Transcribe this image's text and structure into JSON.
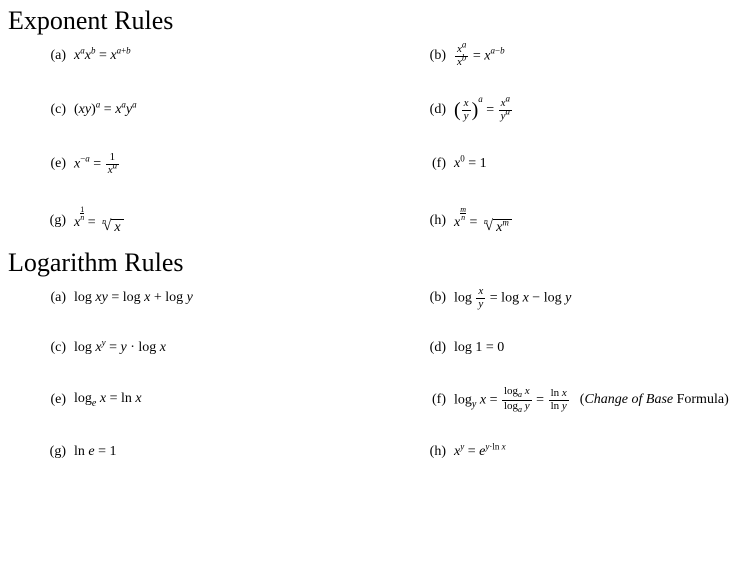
{
  "sections": {
    "exponent": {
      "title": "Exponent Rules",
      "items": {
        "a": {
          "label": "(a)"
        },
        "b": {
          "label": "(b)"
        },
        "c": {
          "label": "(c)"
        },
        "d": {
          "label": "(d)"
        },
        "e": {
          "label": "(e)"
        },
        "f": {
          "label": "(f)"
        },
        "g": {
          "label": "(g)"
        },
        "h": {
          "label": "(h)"
        }
      }
    },
    "logarithm": {
      "title": "Logarithm Rules",
      "items": {
        "a": {
          "label": "(a)"
        },
        "b": {
          "label": "(b)"
        },
        "c": {
          "label": "(c)"
        },
        "d": {
          "label": "(d)"
        },
        "e": {
          "label": "(e)"
        },
        "f": {
          "label": "(f)",
          "note_italic": "Change of Base",
          "note_plain": " Formula"
        },
        "g": {
          "label": "(g)"
        },
        "h": {
          "label": "(h)"
        }
      }
    }
  },
  "chart_data": [
    {
      "type": "table",
      "title": "Exponent Rules",
      "rows": [
        {
          "label": "(a)",
          "rule": "x^a * x^b = x^(a+b)"
        },
        {
          "label": "(b)",
          "rule": "x^a / x^b = x^(a-b)"
        },
        {
          "label": "(c)",
          "rule": "(xy)^a = x^a * y^a"
        },
        {
          "label": "(d)",
          "rule": "(x/y)^a = x^a / y^a"
        },
        {
          "label": "(e)",
          "rule": "x^(-a) = 1 / x^a"
        },
        {
          "label": "(f)",
          "rule": "x^0 = 1"
        },
        {
          "label": "(g)",
          "rule": "x^(1/n) = n-th root of x"
        },
        {
          "label": "(h)",
          "rule": "x^(m/n) = n-th root of x^m"
        }
      ]
    },
    {
      "type": "table",
      "title": "Logarithm Rules",
      "rows": [
        {
          "label": "(a)",
          "rule": "log(xy) = log x + log y"
        },
        {
          "label": "(b)",
          "rule": "log(x/y) = log x - log y"
        },
        {
          "label": "(c)",
          "rule": "log(x^y) = y * log x"
        },
        {
          "label": "(d)",
          "rule": "log 1 = 0"
        },
        {
          "label": "(e)",
          "rule": "log_e x = ln x"
        },
        {
          "label": "(f)",
          "rule": "log_y x = log_a x / log_a y = ln x / ln y",
          "note": "Change of Base Formula"
        },
        {
          "label": "(g)",
          "rule": "ln e = 1"
        },
        {
          "label": "(h)",
          "rule": "x^y = e^(y * ln x)"
        }
      ]
    }
  ]
}
